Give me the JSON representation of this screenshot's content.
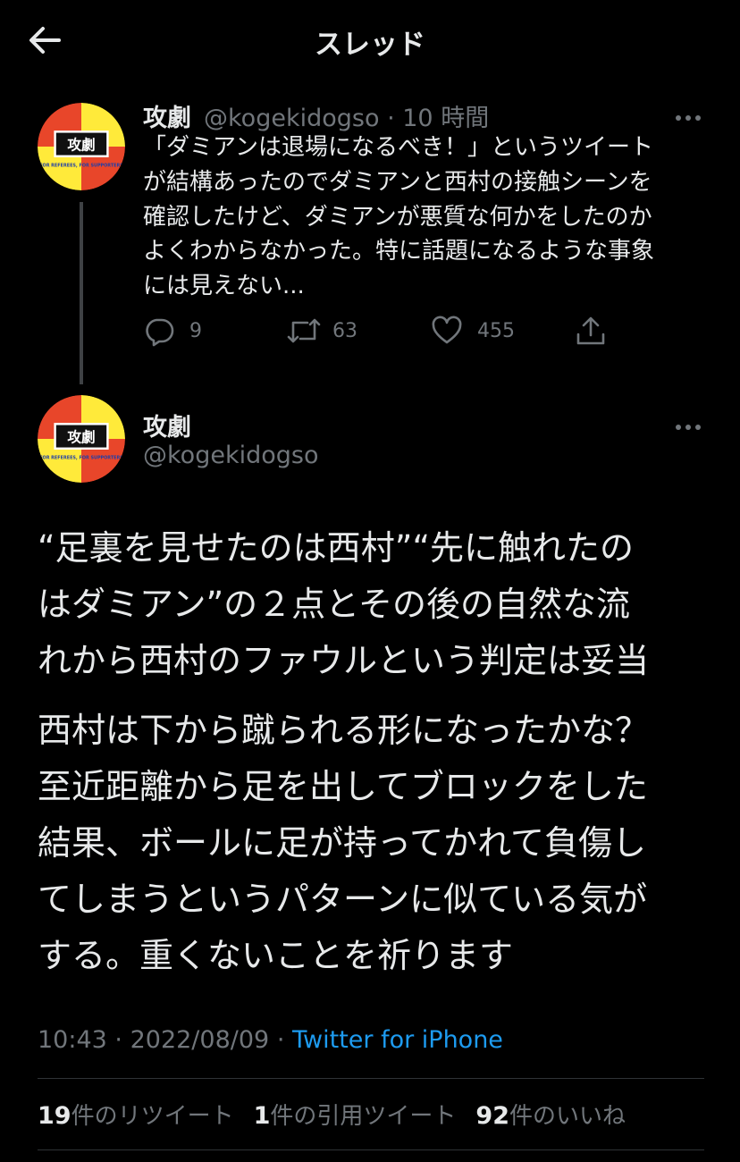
{
  "header": {
    "title": "スレッド"
  },
  "reply_tweet": {
    "author_name": "攻劇",
    "handle": "@kogekidogso",
    "separator": "·",
    "time_ago": "10 時間",
    "avatar_label": "攻劇",
    "avatar_tagline": "FOR REFEREES, FOR SUPPORTERS",
    "text_lines": [
      "「ダミアンは退場になるべき！」というツイート",
      "が結構あったのでダミアンと西村の接触シーンを",
      "確認したけど、ダミアンが悪質な何かをしたのか",
      "よくわからなかった。特に話題になるような事象",
      "には見えない..."
    ],
    "actions": {
      "replies": "9",
      "retweets": "63",
      "likes": "455"
    }
  },
  "main_tweet": {
    "author_name": "攻劇",
    "handle": "@kogekidogso",
    "avatar_label": "攻劇",
    "avatar_tagline": "FOR REFEREES, FOR SUPPORTERS",
    "paragraph1": [
      "“足裏を見せたのは西村”“先に触れたの",
      "はダミアン”の２点とその後の自然な流",
      "れから西村のファウルという判定は妥当"
    ],
    "paragraph2": [
      "西村は下から蹴られる形になったかな？",
      "至近距離から足を出してブロックをした",
      "結果、ボールに足が持ってかれて負傷し",
      "てしまうというパターンに似ている気が",
      "する。重くないことを祈ります"
    ],
    "time": "10:43",
    "date": "2022/08/09",
    "separator": "·",
    "source": "Twitter for iPhone",
    "stats": {
      "retweets_count": "19",
      "retweets_label": "件のリツイート",
      "quotes_count": "1",
      "quotes_label": "件の引用ツイート",
      "likes_count": "92",
      "likes_label": "件のいいね"
    }
  },
  "icons": [
    "back-arrow-icon",
    "more-icon",
    "reply-icon",
    "retweet-icon",
    "like-icon",
    "share-icon"
  ],
  "colors": {
    "background": "#000000",
    "text": "#e7e9ea",
    "secondary": "#71767b",
    "link": "#1d9bf0",
    "divider": "#2f3336"
  }
}
